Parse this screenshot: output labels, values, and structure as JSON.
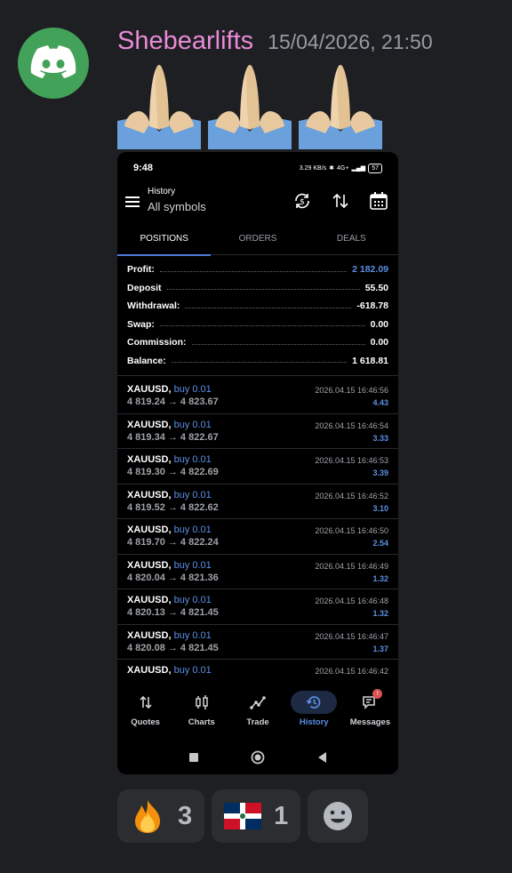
{
  "message": {
    "username": "Shebearlifts",
    "timestamp": "15/04/2026, 21:50",
    "emoji": [
      "pray",
      "pray",
      "pray"
    ]
  },
  "phone": {
    "status": {
      "time": "9:48",
      "speed": "3.29 KB/s",
      "network": "4G+",
      "battery": "57"
    },
    "app_bar": {
      "title": "History",
      "subtitle": "All symbols",
      "actions": [
        "refresh-currency-icon",
        "sort-icon",
        "calendar-icon"
      ]
    },
    "tabs": [
      {
        "label": "POSITIONS",
        "active": true
      },
      {
        "label": "ORDERS",
        "active": false
      },
      {
        "label": "DEALS",
        "active": false
      }
    ],
    "summary": [
      {
        "label": "Profit:",
        "value": "2 182.09"
      },
      {
        "label": "Deposit",
        "value": "55.50"
      },
      {
        "label": "Withdrawal:",
        "value": "-618.78"
      },
      {
        "label": "Swap:",
        "value": "0.00"
      },
      {
        "label": "Commission:",
        "value": "0.00"
      },
      {
        "label": "Balance:",
        "value": "1 618.81"
      }
    ],
    "deals": [
      {
        "symbol": "XAUUSD,",
        "type": "buy 0.01",
        "prices": "4 819.24 → 4 823.67",
        "time": "2026.04.15 16:46:56",
        "profit": "4.43"
      },
      {
        "symbol": "XAUUSD,",
        "type": "buy 0.01",
        "prices": "4 819.34 → 4 822.67",
        "time": "2026.04.15 16:46:54",
        "profit": "3.33"
      },
      {
        "symbol": "XAUUSD,",
        "type": "buy 0.01",
        "prices": "4 819.30 → 4 822.69",
        "time": "2026.04.15 16:46:53",
        "profit": "3.39"
      },
      {
        "symbol": "XAUUSD,",
        "type": "buy 0.01",
        "prices": "4 819.52 → 4 822.62",
        "time": "2026.04.15 16:46:52",
        "profit": "3.10"
      },
      {
        "symbol": "XAUUSD,",
        "type": "buy 0.01",
        "prices": "4 819.70 → 4 822.24",
        "time": "2026.04.15 16:46:50",
        "profit": "2.54"
      },
      {
        "symbol": "XAUUSD,",
        "type": "buy 0.01",
        "prices": "4 820.04 → 4 821.36",
        "time": "2026.04.15 16:46:49",
        "profit": "1.32"
      },
      {
        "symbol": "XAUUSD,",
        "type": "buy 0.01",
        "prices": "4 820.13 → 4 821.45",
        "time": "2026.04.15 16:46:48",
        "profit": "1.32"
      },
      {
        "symbol": "XAUUSD,",
        "type": "buy 0.01",
        "prices": "4 820.08 → 4 821.45",
        "time": "2026.04.15 16:46:47",
        "profit": "1.37"
      },
      {
        "symbol": "XAUUSD,",
        "type": "buy 0.01",
        "prices": "",
        "time": "2026.04.15 16:46:42",
        "profit": ""
      }
    ],
    "nav": [
      {
        "label": "Quotes",
        "icon": "quotes-icon"
      },
      {
        "label": "Charts",
        "icon": "charts-icon"
      },
      {
        "label": "Trade",
        "icon": "trade-icon"
      },
      {
        "label": "History",
        "icon": "history-icon",
        "active": true
      },
      {
        "label": "Messages",
        "icon": "messages-icon",
        "badge": "!"
      }
    ]
  },
  "reactions": [
    {
      "emoji": "fire",
      "count": "3"
    },
    {
      "emoji": "dominican-republic-flag",
      "count": "1"
    },
    {
      "emoji": "add-reaction",
      "count": ""
    }
  ],
  "colors": {
    "background": "#1e1f22",
    "username": "#e88bd6",
    "accent_blue": "#5b8fe6",
    "avatar_green": "#43a25a"
  }
}
